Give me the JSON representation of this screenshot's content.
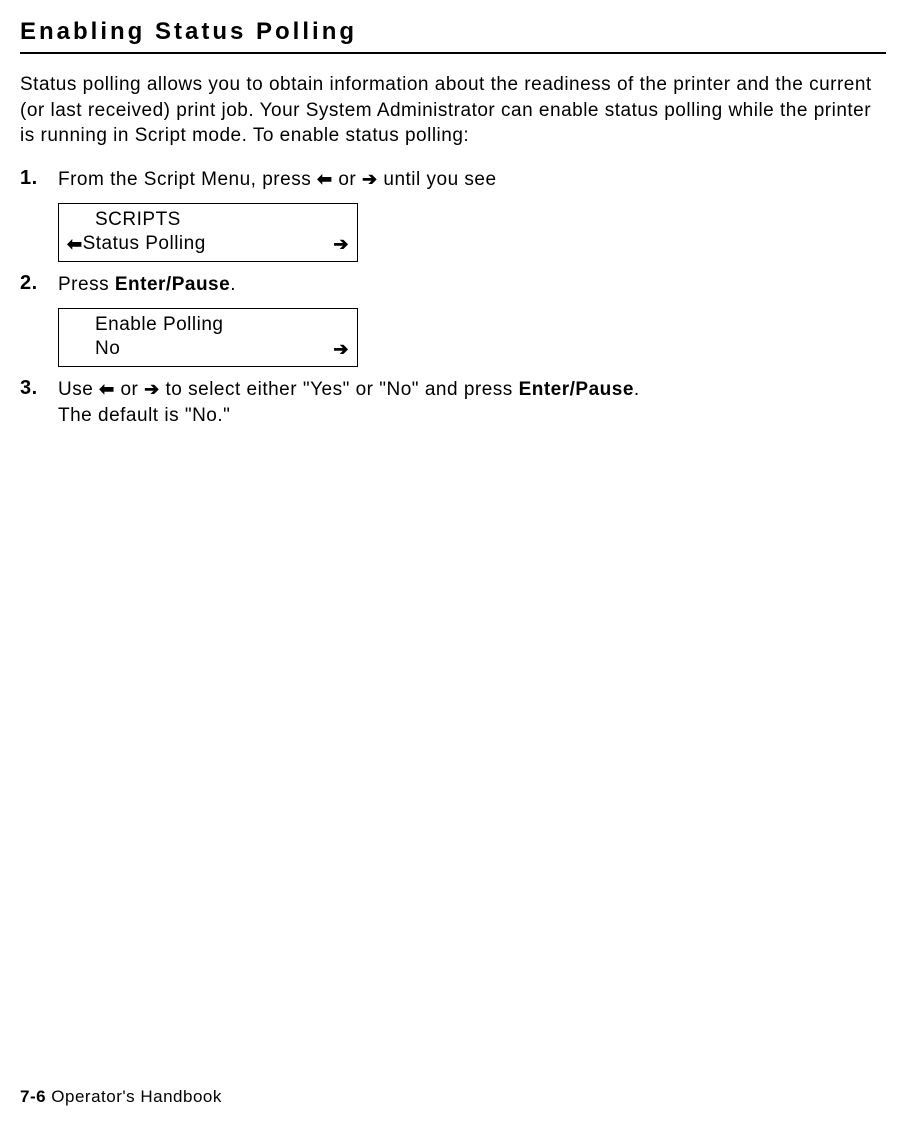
{
  "title": "Enabling Status Polling",
  "intro": "Status polling allows you to obtain information about the readiness of the printer and the current (or last received) print job.  Your System Administrator can enable status polling while the printer is running in Script mode.  To enable status polling:",
  "steps": [
    {
      "num": "1.",
      "text_before": "From the Script Menu, press ",
      "text_mid": " or ",
      "text_after": " until you see",
      "display": {
        "line1_indent": "SCRIPTS",
        "line2_left_arrow": "⬅",
        "line2_text": "Status Polling",
        "line2_right_arrow": "➔"
      }
    },
    {
      "num": "2.",
      "text_before": "Press ",
      "bold": "Enter/Pause",
      "text_after": ".",
      "display": {
        "line1_indent": "Enable Polling",
        "line2_text": "No",
        "line2_right_arrow": "➔"
      }
    },
    {
      "num": "3.",
      "text_before": "Use ",
      "text_mid": " or ",
      "text_after1": " to select either \"Yes\" or \"No\" and press ",
      "bold": "Enter/Pause",
      "text_after2": ".  ",
      "line2": "The default is \"No.\""
    }
  ],
  "arrows": {
    "left": "⬅",
    "right": "➔"
  },
  "footer": {
    "page": "7-6",
    "label": "  Operator's Handbook"
  }
}
